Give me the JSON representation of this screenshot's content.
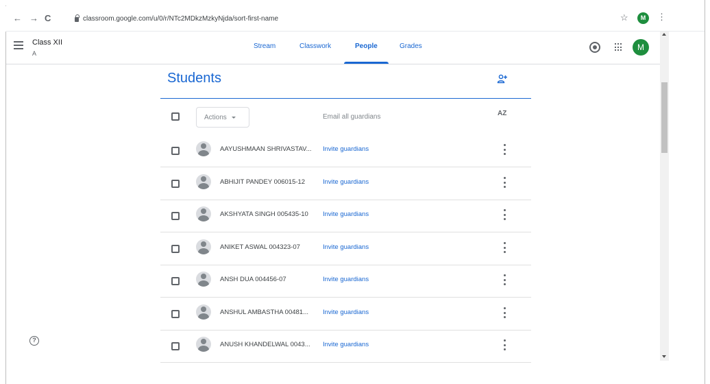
{
  "browser": {
    "url": "classroom.google.com/u/0/r/NTc2MDkzMzkyNjda/sort-first-name",
    "back_icon": "←",
    "forward_icon": "→",
    "reload_icon": "C",
    "star_icon": "☆",
    "avatar_letter": "M",
    "menu_icon": "⋮"
  },
  "header": {
    "class_name": "Class XII",
    "section": "A",
    "tabs": [
      {
        "label": "Stream"
      },
      {
        "label": "Classwork"
      },
      {
        "label": "People",
        "active": true
      },
      {
        "label": "Grades"
      }
    ],
    "avatar_letter": "M"
  },
  "students": {
    "title": "Students",
    "actions_label": "Actions",
    "email_guardians_label": "Email all guardians",
    "sort_label": "AZ",
    "rows": [
      {
        "name": "AAYUSHMAAN SHRIVASTAV...",
        "action": "Invite guardians"
      },
      {
        "name": "ABHIJIT PANDEY 006015-12",
        "action": "Invite guardians"
      },
      {
        "name": "AKSHYATA SINGH 005435-10",
        "action": "Invite guardians"
      },
      {
        "name": "ANIKET ASWAL 004323-07",
        "action": "Invite guardians"
      },
      {
        "name": "ANSH DUA 004456-07",
        "action": "Invite guardians"
      },
      {
        "name": "ANSHUL AMBASTHA 00481...",
        "action": "Invite guardians"
      },
      {
        "name": "ANUSH KHANDELWAL 0043...",
        "action": "Invite guardians"
      }
    ]
  },
  "help_icon": "?",
  "colors": {
    "accent": "#1967d2",
    "avatar_green": "#1e8e3e"
  }
}
